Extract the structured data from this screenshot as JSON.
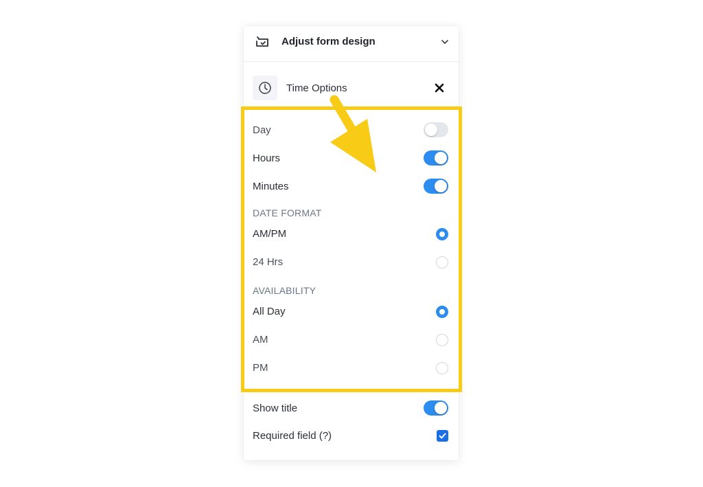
{
  "header": {
    "title": "Adjust form design",
    "icon": "form-design-icon"
  },
  "section": {
    "title": "Time Options",
    "icon": "clock-icon"
  },
  "time_units": [
    {
      "label": "Day",
      "enabled": false
    },
    {
      "label": "Hours",
      "enabled": true
    },
    {
      "label": "Minutes",
      "enabled": true
    }
  ],
  "date_format": {
    "heading": "DATE FORMAT",
    "options": [
      {
        "label": "AM/PM",
        "selected": true
      },
      {
        "label": "24 Hrs",
        "selected": false
      }
    ]
  },
  "availability": {
    "heading": "AVAILABILITY",
    "options": [
      {
        "label": "All Day",
        "selected": true
      },
      {
        "label": "AM",
        "selected": false
      },
      {
        "label": "PM",
        "selected": false
      }
    ]
  },
  "show_title": {
    "label": "Show title",
    "enabled": true
  },
  "required_field": {
    "label": "Required field (?)",
    "checked": true
  },
  "colors": {
    "accent": "#2d8cf0",
    "highlight": "#f8cb16",
    "checkbox": "#1b6fe6"
  }
}
